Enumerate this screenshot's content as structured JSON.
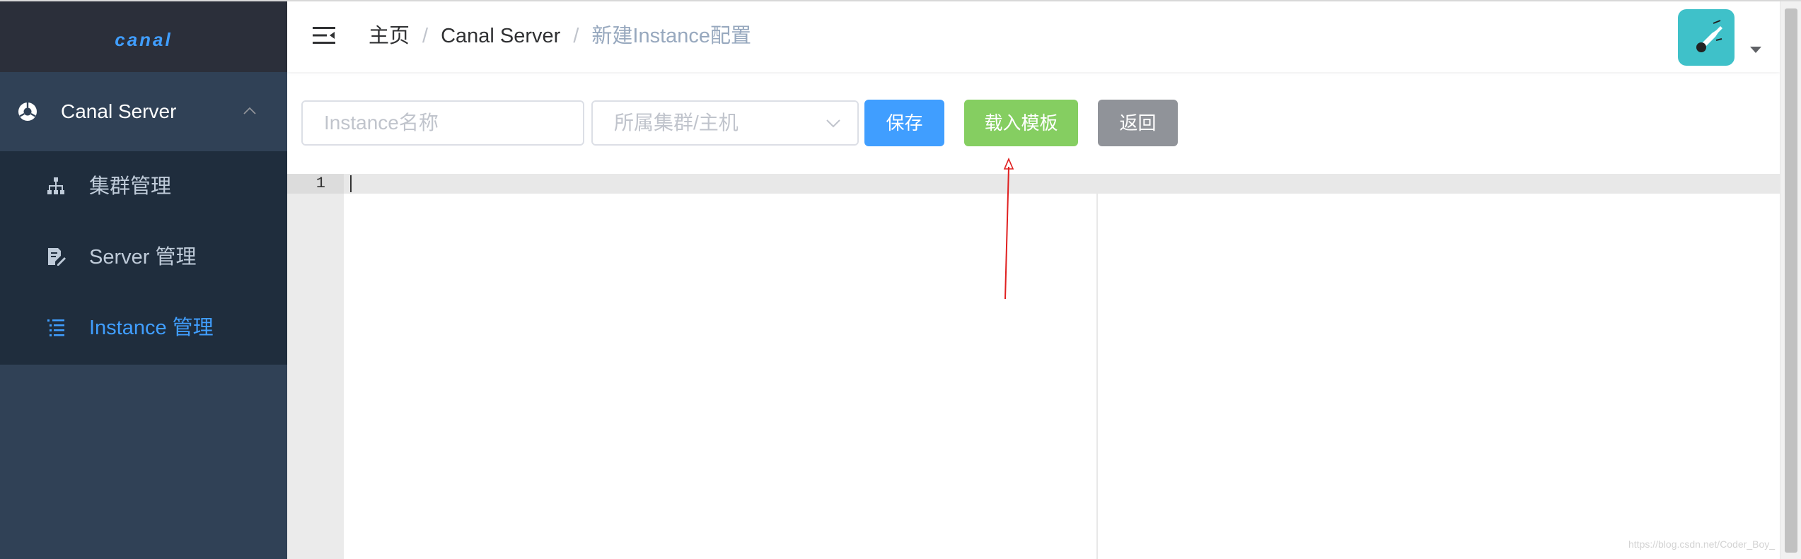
{
  "app": {
    "logo": "canal"
  },
  "sidebar": {
    "parent": {
      "label": "Canal Server",
      "icon": "chrome-like-icon",
      "expanded": true
    },
    "items": [
      {
        "label": "集群管理",
        "icon": "sitemap-icon",
        "active": false
      },
      {
        "label": "Server 管理",
        "icon": "edit-doc-icon",
        "active": false
      },
      {
        "label": "Instance 管理",
        "icon": "list-icon",
        "active": true
      }
    ]
  },
  "header": {
    "breadcrumb": {
      "home": "主页",
      "server": "Canal Server",
      "current": "新建Instance配置",
      "separator": "/"
    }
  },
  "toolbar": {
    "name_placeholder": "Instance名称",
    "cluster_placeholder": "所属集群/主机",
    "save_label": "保存",
    "load_template_label": "载入模板",
    "back_label": "返回"
  },
  "editor": {
    "line_numbers": [
      "1"
    ]
  },
  "watermark": "https://blog.csdn.net/Coder_Boy_",
  "colors": {
    "sidebar_bg": "#304156",
    "submenu_bg": "#1f2d3d",
    "logo_bg": "#2b2f3a",
    "primary": "#409eff",
    "success": "#85ce61",
    "info": "#909399",
    "avatar_bg": "#3fc1c9",
    "annotation_arrow": "#e02020"
  }
}
